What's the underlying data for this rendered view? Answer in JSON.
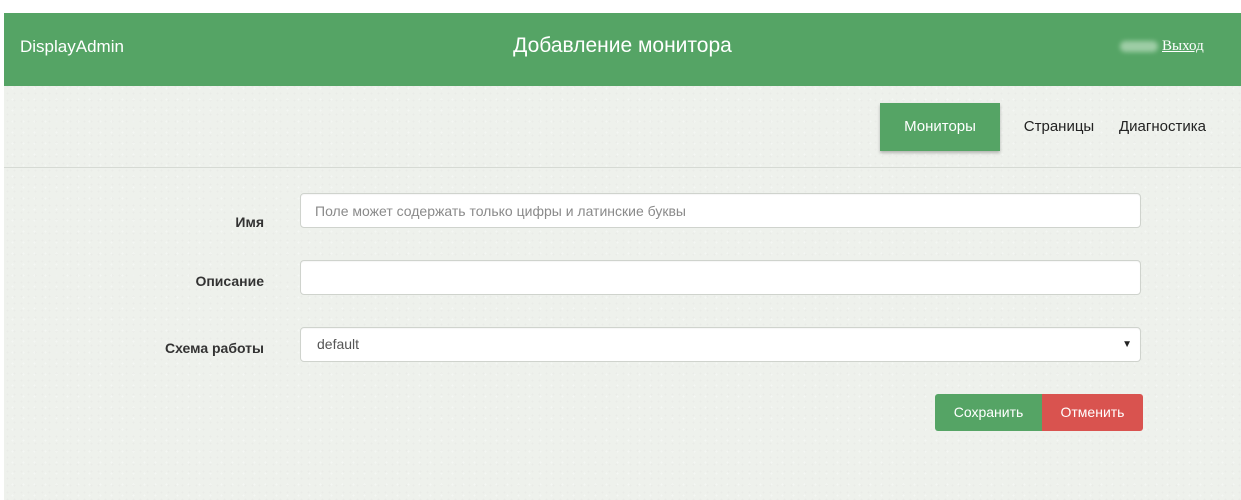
{
  "header": {
    "brand": "DisplayAdmin",
    "title": "Добавление монитора",
    "logout_label": "Выход"
  },
  "nav": {
    "items": [
      {
        "label": "Мониторы",
        "active": true
      },
      {
        "label": "Страницы",
        "active": false
      },
      {
        "label": "Диагностика",
        "active": false
      }
    ]
  },
  "form": {
    "name": {
      "label": "Имя",
      "value": "",
      "placeholder": "Поле может содержать только цифры и латинские буквы"
    },
    "description": {
      "label": "Описание",
      "value": "",
      "placeholder": ""
    },
    "scheme": {
      "label": "Схема работы",
      "selected": "default"
    }
  },
  "actions": {
    "save_label": "Сохранить",
    "cancel_label": "Отменить"
  },
  "colors": {
    "primary": "#55a465",
    "danger": "#d9534f",
    "background": "#eef1ec"
  },
  "icons": {
    "select_caret": "caret-down-icon"
  }
}
